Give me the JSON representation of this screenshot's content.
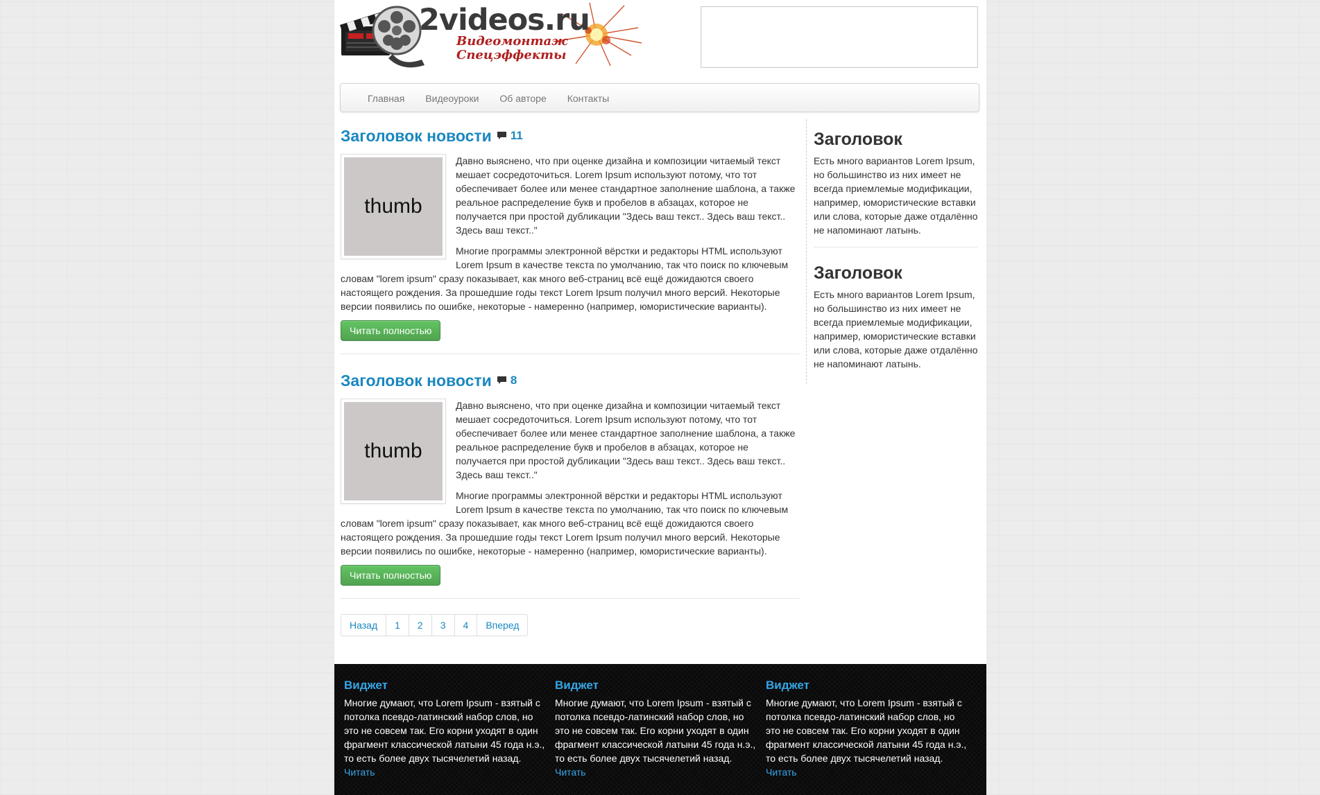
{
  "header": {
    "logo_text": "2videos.ru",
    "tagline_1": "Видеомонтаж",
    "tagline_2": "Спецэффекты"
  },
  "nav": {
    "items": [
      {
        "label": "Главная"
      },
      {
        "label": "Видеоуроки"
      },
      {
        "label": "Об авторе"
      },
      {
        "label": "Контакты"
      }
    ]
  },
  "posts": [
    {
      "title": "Заголовок новости",
      "comments": "11",
      "thumb_label": "thumb",
      "paragraph_1": "Давно выяснено, что при оценке дизайна и композиции читаемый текст мешает сосредоточиться. Lorem Ipsum используют потому, что тот обеспечивает более или менее стандартное заполнение шаблона, а также реальное распределение букв и пробелов в абзацах, которое не получается при простой дубликации \"Здесь ваш текст.. Здесь ваш текст.. Здесь ваш текст..\"",
      "paragraph_2": "Многие программы электронной вёрстки и редакторы HTML используют Lorem Ipsum в качестве текста по умолчанию, так что поиск по ключевым словам \"lorem ipsum\" сразу показывает, как много веб-страниц всё ещё дожидаются своего настоящего рождения. За прошедшие годы текст Lorem Ipsum получил много версий. Некоторые версии появились по ошибке, некоторые - намеренно (например, юмористические варианты).",
      "button": "Читать полностью"
    },
    {
      "title": "Заголовок новости",
      "comments": "8",
      "thumb_label": "thumb",
      "paragraph_1": "Давно выяснено, что при оценке дизайна и композиции читаемый текст мешает сосредоточиться. Lorem Ipsum используют потому, что тот обеспечивает более или менее стандартное заполнение шаблона, а также реальное распределение букв и пробелов в абзацах, которое не получается при простой дубликации \"Здесь ваш текст.. Здесь ваш текст.. Здесь ваш текст..\"",
      "paragraph_2": "Многие программы электронной вёрстки и редакторы HTML используют Lorem Ipsum в качестве текста по умолчанию, так что поиск по ключевым словам \"lorem ipsum\" сразу показывает, как много веб-страниц всё ещё дожидаются своего настоящего рождения. За прошедшие годы текст Lorem Ipsum получил много версий. Некоторые версии появились по ошибке, некоторые - намеренно (например, юмористические варианты).",
      "button": "Читать полностью"
    }
  ],
  "pagination": {
    "prev": "Назад",
    "pages": [
      "1",
      "2",
      "3",
      "4"
    ],
    "next": "Вперед"
  },
  "sidebar": [
    {
      "title": "Заголовок",
      "text": "Есть много вариантов Lorem Ipsum, но большинство из них имеет не всегда приемлемые модификации, например, юмористические вставки или слова, которые даже отдалённо не напоминают латынь."
    },
    {
      "title": "Заголовок",
      "text": "Есть много вариантов Lorem Ipsum, но большинство из них имеет не всегда приемлемые модификации, например, юмористические вставки или слова, которые даже отдалённо не напоминают латынь."
    }
  ],
  "footer": {
    "widgets": [
      {
        "title": "Виджет",
        "text": "Многие думают, что Lorem Ipsum - взятый с потолка псевдо-латинский набор слов, но это не совсем так. Его корни уходят в один фрагмент классической латыни 45 года н.э., то есть более двух тысячелетий назад.",
        "link": "Читать"
      },
      {
        "title": "Виджет",
        "text": "Многие думают, что Lorem Ipsum - взятый с потолка псевдо-латинский набор слов, но это не совсем так. Его корни уходят в один фрагмент классической латыни 45 года н.э., то есть более двух тысячелетий назад.",
        "link": "Читать"
      },
      {
        "title": "Виджет",
        "text": "Многие думают, что Lorem Ipsum - взятый с потолка псевдо-латинский набор слов, но это не совсем так. Его корни уходят в один фрагмент классической латыни 45 года н.э., то есть более двух тысячелетий назад.",
        "link": "Читать"
      }
    ]
  },
  "colors": {
    "link": "#1a87c0",
    "button_green": "#5bb75b",
    "footer_bg": "#0a0a0a",
    "footer_title": "#35a6e8"
  },
  "icons": {
    "logo": "film-clapperboard-reel-icon",
    "comments": "comment-bubble-icon"
  }
}
